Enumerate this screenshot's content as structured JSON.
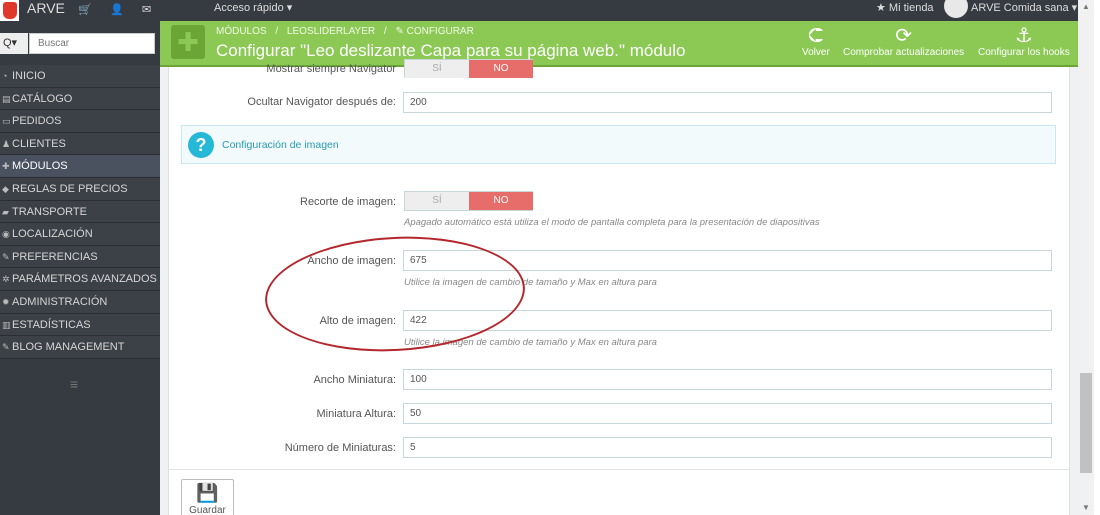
{
  "topbar": {
    "brand": "ARVE",
    "quick_access": "Acceso rápido ▾",
    "my_store": "★ Mi tienda",
    "user": "ARVE Comida sana ▾"
  },
  "sidebar": {
    "search_placeholder": "Buscar",
    "search_button": "Q▾",
    "items": [
      {
        "label": "INICIO",
        "icon": "chart-icon"
      },
      {
        "label": "CATÁLOGO",
        "icon": "book-icon"
      },
      {
        "label": "PEDIDOS",
        "icon": "credit-card-icon"
      },
      {
        "label": "CLIENTES",
        "icon": "users-icon"
      },
      {
        "label": "MÓDULOS",
        "icon": "puzzle-icon",
        "active": true
      },
      {
        "label": "REGLAS DE PRECIOS",
        "icon": "tag-icon"
      },
      {
        "label": "TRANSPORTE",
        "icon": "truck-icon"
      },
      {
        "label": "LOCALIZACIÓN",
        "icon": "globe-icon"
      },
      {
        "label": "PREFERENCIAS",
        "icon": "wrench-icon"
      },
      {
        "label": "PARÁMETROS AVANZADOS",
        "icon": "cogs-icon"
      },
      {
        "label": "ADMINISTRACIÓN",
        "icon": "gear-icon"
      },
      {
        "label": "ESTADÍSTICAS",
        "icon": "bar-chart-icon"
      },
      {
        "label": "BLOG MANAGEMENT",
        "icon": "wrench-icon"
      }
    ],
    "collapse_icon": "≡"
  },
  "header": {
    "breadcrumb": [
      "MÓDULOS",
      "/",
      "LEOSLIDERLAYER",
      "/",
      "✎ CONFIGURAR"
    ],
    "title": "Configurar \"Leo deslizante Capa para su página web.\" módulo",
    "buttons": {
      "back": "Volver",
      "check_updates": "Comprobar actualizaciones",
      "hooks": "Configurar los hooks"
    },
    "accent": "#8bc954"
  },
  "form": {
    "navigator_always": {
      "label": "Mostrar siempre Navigator",
      "yes": "SÍ",
      "no": "NO"
    },
    "hide_navigator": {
      "label": "Ocultar Navigator después de:",
      "value": "200"
    },
    "section_title": "Configuración de imagen",
    "image_crop": {
      "label": "Recorte de imagen:",
      "yes": "SÍ",
      "no": "NO",
      "help": "Apagado automático está utiliza el modo de pantalla completa para la presentación de diapositivas"
    },
    "image_width": {
      "label": "Ancho de imagen:",
      "value": "675",
      "help": "Utilice la imagen de cambio de tamaño y Max en altura para"
    },
    "image_height": {
      "label": "Alto de imagen:",
      "value": "422",
      "help": "Utilice la imagen de cambio de tamaño y Max en altura para"
    },
    "thumb_width": {
      "label": "Ancho Miniatura:",
      "value": "100"
    },
    "thumb_height": {
      "label": "Miniatura Altura:",
      "value": "50"
    },
    "thumb_count": {
      "label": "Número de Miniaturas:",
      "value": "5"
    },
    "save_label": "Guardar"
  }
}
